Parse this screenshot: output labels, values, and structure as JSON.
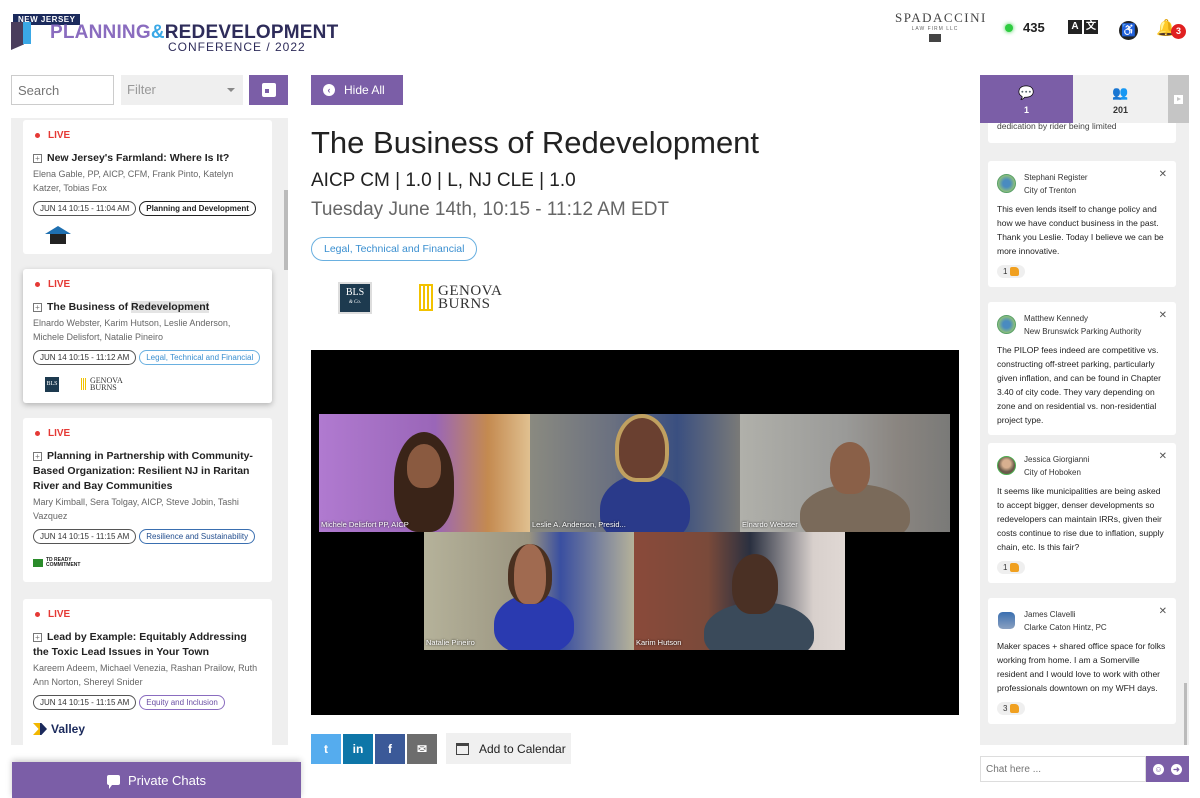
{
  "header": {
    "logo": {
      "tag": "NEW JERSEY",
      "word1": "PLANNING",
      "amp": "&",
      "word2": "REDEVELOPMENT",
      "sub": "CONFERENCE / 2022"
    },
    "sponsor": {
      "name": "SPADACCINI",
      "sub": "LAW FIRM LLC"
    },
    "online_count": "435",
    "translate_icon": [
      "A",
      "文"
    ],
    "notification_count": "3"
  },
  "sidebar": {
    "search_placeholder": "Search",
    "filter_label": "Filter",
    "sessions": [
      {
        "status": "LIVE",
        "title": "New Jersey's Farmland: Where Is It?",
        "speakers": "Elena Gable, PP, AICP, CFM, Frank Pinto, Katelyn Katzer, Tobias Fox",
        "time": "JUN 14 10:15 - 11:04 AM",
        "track": "Planning and Development"
      },
      {
        "status": "LIVE",
        "title_prefix": "The Business of ",
        "title_highlight": "Redevelopment",
        "speakers": "Elnardo Webster, Karim Hutson, Leslie Anderson, Michele Delisfort, Natalie Pineiro",
        "time": "JUN 14 10:15 - 11:12 AM",
        "track": "Legal, Technical and Financial",
        "sponsors": [
          "BLS",
          "GENOVA BURNS"
        ]
      },
      {
        "status": "LIVE",
        "title": "Planning in Partnership with Community-Based Organization: Resilient NJ in Raritan River and Bay Communities",
        "speakers": "Mary Kimball, Sera Tolgay, AICP, Steve Jobin, Tashi Vazquez",
        "time": "JUN 14 10:15 - 11:15 AM",
        "track": "Resilience and Sustainability",
        "sponsor": "TD READY COMMITMENT"
      },
      {
        "status": "LIVE",
        "title": "Lead by Example: Equitably Addressing the Toxic Lead Issues in Your Town",
        "speakers": "Kareem Adeem, Michael Venezia, Rashan Prailow, Ruth Ann Norton, Shereyl Snider",
        "time": "JUN 14 10:15 - 11:15 AM",
        "track": "Equity and Inclusion",
        "sponsor": "Valley"
      }
    ],
    "private_chats_label": "Private Chats"
  },
  "main": {
    "hide_all_label": "Hide All",
    "title": "The Business of Redevelopment",
    "credits": "AICP CM | 1.0 | L, NJ CLE | 1.0",
    "datetime": "Tuesday June 14th, 10:15 - 11:12 AM EDT",
    "track": "Legal, Technical and Financial",
    "sponsors": {
      "bls": "BLS",
      "bls_sub": "& Co.",
      "genova_1": "GENOVA",
      "genova_2": "BURNS"
    },
    "video_participants": [
      "Michele Delisfort PP, AICP",
      "Leslie A.  Anderson, Presid...",
      "Elnardo Webster",
      "Natalie Pineiro",
      "Karim Hutson"
    ],
    "share": {
      "twitter": "t",
      "linkedin": "in",
      "facebook": "f",
      "email": "✉"
    },
    "add_to_calendar_label": "Add to Calendar"
  },
  "chat": {
    "tabs": {
      "chat_count": "1",
      "people_count": "201"
    },
    "truncated_top": "dedication by rider being limited",
    "messages": [
      {
        "name": "Stephani Register",
        "org": "City of Trenton",
        "text": "This even lends itself to change  policy and how we have conduct business in the past. Thank you Leslie. Today I believe we can be more innovative.",
        "likes": "1"
      },
      {
        "name": "Matthew Kennedy",
        "org": "New Brunswick Parking Authority",
        "text": "The PILOP fees indeed are competitive vs. constructing off-street parking, particularly given inflation, and can be found in Chapter 3.40 of city code.  They vary depending on zone and on residential vs. non-residential project type."
      },
      {
        "name": "Jessica Giorgianni",
        "org": "City of Hoboken",
        "text": "It seems like municipalities are being asked to accept bigger, denser developments so redevelopers can maintain IRRs, given their costs continue to rise due to inflation, supply chain, etc.  Is this fair?",
        "likes": "1"
      },
      {
        "name": "James Clavelli",
        "org": "Clarke Caton Hintz, PC",
        "text": "Maker spaces + shared office space for folks working from home. I am a Somerville resident and I would love to work with other professionals downtown on my WFH days.",
        "likes": "3"
      }
    ],
    "input_placeholder": "Chat here ..."
  },
  "colors": {
    "accent": "#7b5ea7",
    "live": "#e53935",
    "online": "#2ecc40",
    "badge": "#e02020",
    "twitter": "#55acee",
    "linkedin": "#0e76a8",
    "facebook": "#3b5998",
    "email": "#6d6d6d"
  }
}
